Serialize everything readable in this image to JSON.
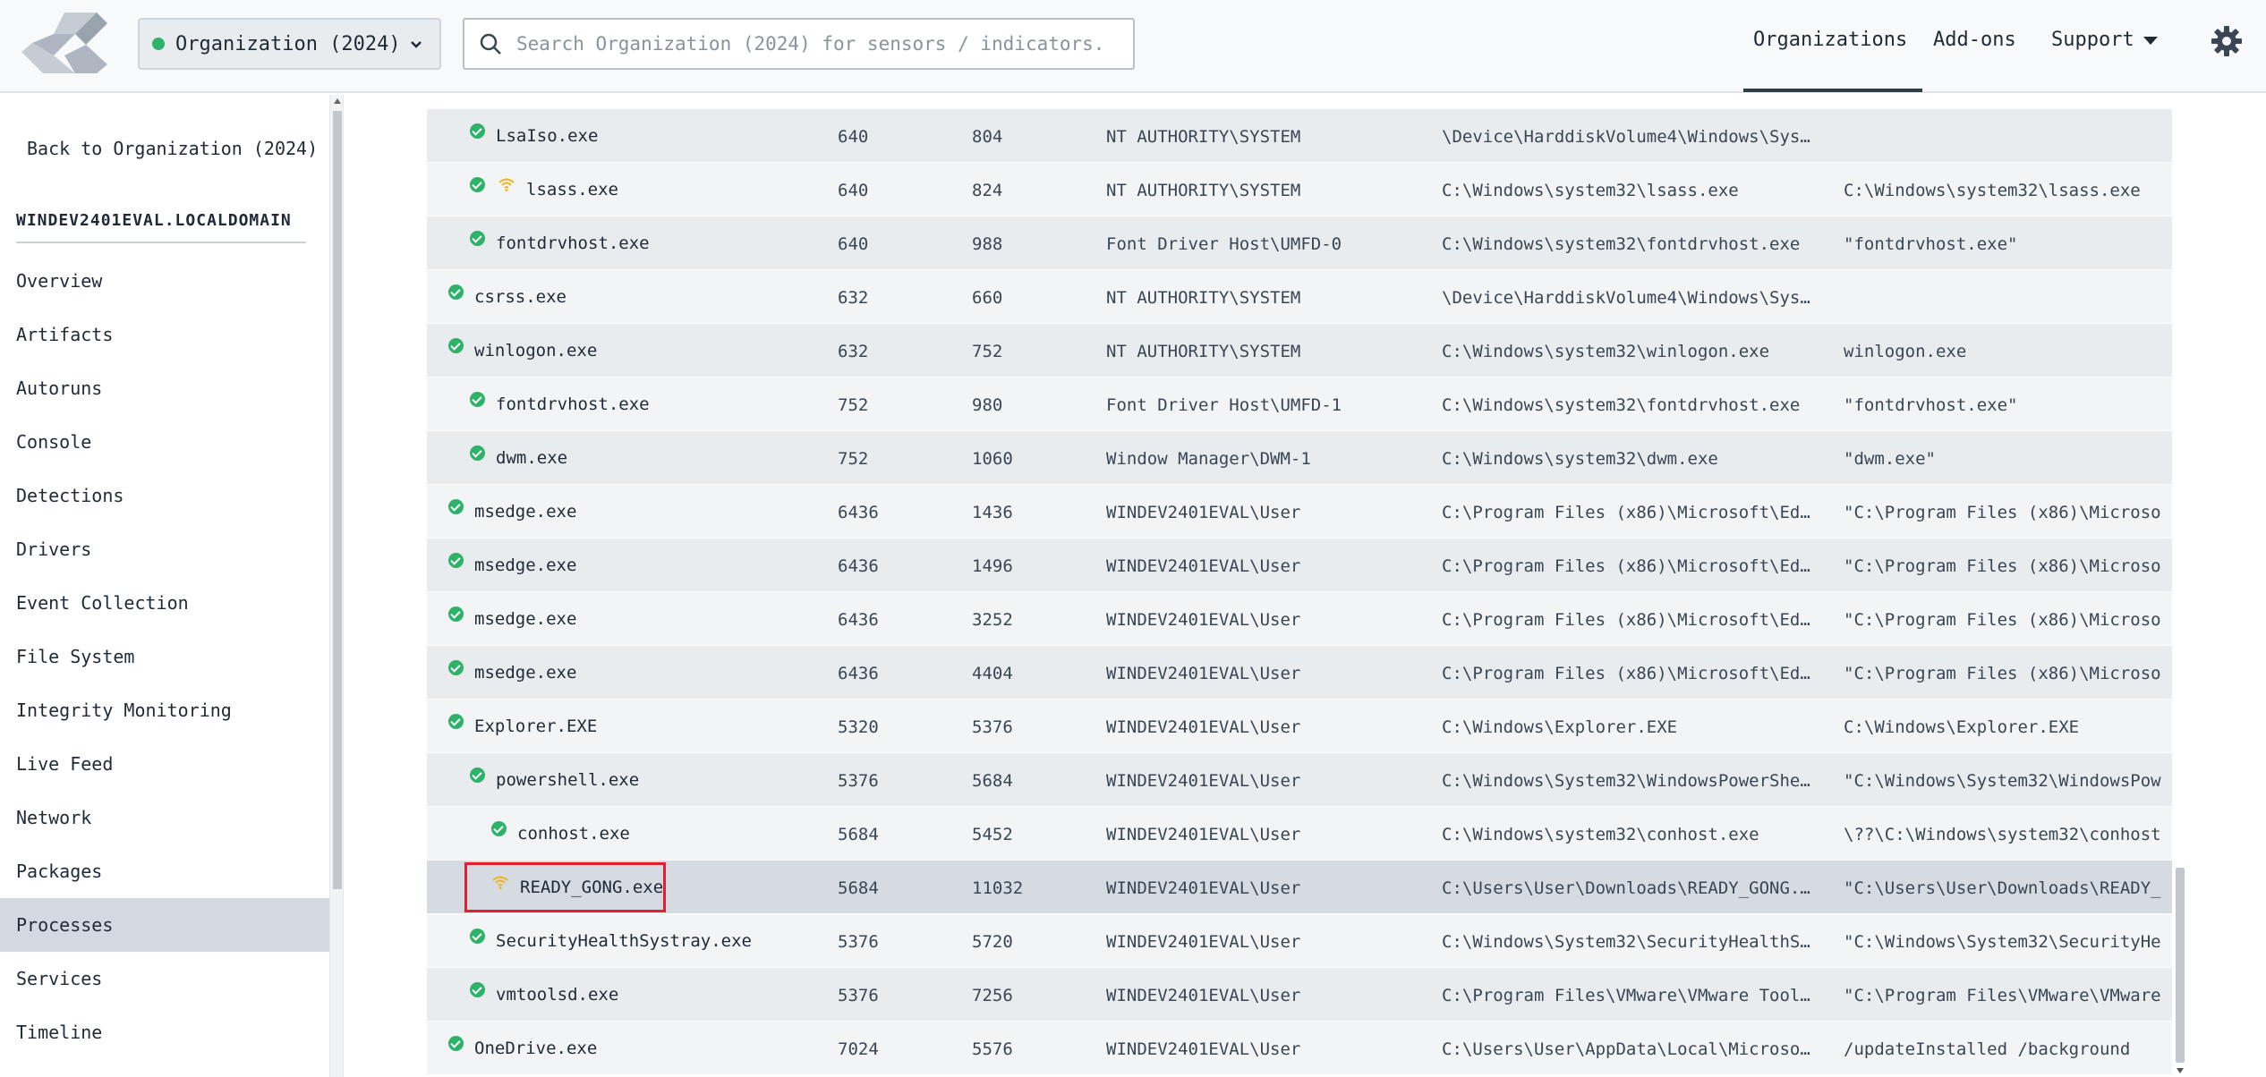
{
  "header": {
    "org_selector": "Organization (2024)",
    "search_placeholder": "Search Organization (2024) for sensors / indicators.",
    "nav": {
      "organizations": "Organizations",
      "addons": "Add-ons",
      "support": "Support"
    },
    "icons": [
      "logo-icon",
      "search-icon",
      "chevron-down-icon",
      "gear-icon"
    ]
  },
  "sidebar": {
    "back_label": "Back to Organization (2024)",
    "hostname": "WINDEV2401EVAL.LOCALDOMAIN",
    "items": [
      {
        "label": "Overview"
      },
      {
        "label": "Artifacts"
      },
      {
        "label": "Autoruns"
      },
      {
        "label": "Console"
      },
      {
        "label": "Detections"
      },
      {
        "label": "Drivers"
      },
      {
        "label": "Event Collection"
      },
      {
        "label": "File System"
      },
      {
        "label": "Integrity Monitoring"
      },
      {
        "label": "Live Feed"
      },
      {
        "label": "Network"
      },
      {
        "label": "Packages"
      },
      {
        "label": "Processes",
        "active": true
      },
      {
        "label": "Services"
      },
      {
        "label": "Timeline"
      }
    ]
  },
  "processes": {
    "rows": [
      {
        "name": "LsaIso.exe",
        "level": 1,
        "icons": [
          "ok"
        ],
        "ppid": "640",
        "pid": "804",
        "user": "NT AUTHORITY\\SYSTEM",
        "path": "\\Device\\HarddiskVolume4\\Windows\\Sys…",
        "cmd": ""
      },
      {
        "name": "lsass.exe",
        "level": 1,
        "icons": [
          "ok",
          "wifi"
        ],
        "ppid": "640",
        "pid": "824",
        "user": "NT AUTHORITY\\SYSTEM",
        "path": "C:\\Windows\\system32\\lsass.exe",
        "cmd": "C:\\Windows\\system32\\lsass.exe"
      },
      {
        "name": "fontdrvhost.exe",
        "level": 1,
        "icons": [
          "ok"
        ],
        "ppid": "640",
        "pid": "988",
        "user": "Font Driver Host\\UMFD-0",
        "path": "C:\\Windows\\system32\\fontdrvhost.exe",
        "cmd": "\"fontdrvhost.exe\""
      },
      {
        "name": "csrss.exe",
        "level": 0,
        "icons": [
          "ok"
        ],
        "ppid": "632",
        "pid": "660",
        "user": "NT AUTHORITY\\SYSTEM",
        "path": "\\Device\\HarddiskVolume4\\Windows\\Sys…",
        "cmd": ""
      },
      {
        "name": "winlogon.exe",
        "level": 0,
        "icons": [
          "ok"
        ],
        "ppid": "632",
        "pid": "752",
        "user": "NT AUTHORITY\\SYSTEM",
        "path": "C:\\Windows\\system32\\winlogon.exe",
        "cmd": "winlogon.exe"
      },
      {
        "name": "fontdrvhost.exe",
        "level": 1,
        "icons": [
          "ok"
        ],
        "ppid": "752",
        "pid": "980",
        "user": "Font Driver Host\\UMFD-1",
        "path": "C:\\Windows\\system32\\fontdrvhost.exe",
        "cmd": "\"fontdrvhost.exe\""
      },
      {
        "name": "dwm.exe",
        "level": 1,
        "icons": [
          "ok"
        ],
        "ppid": "752",
        "pid": "1060",
        "user": "Window Manager\\DWM-1",
        "path": "C:\\Windows\\system32\\dwm.exe",
        "cmd": "\"dwm.exe\""
      },
      {
        "name": "msedge.exe",
        "level": 0,
        "icons": [
          "ok"
        ],
        "ppid": "6436",
        "pid": "1436",
        "user": "WINDEV2401EVAL\\User",
        "path": "C:\\Program Files (x86)\\Microsoft\\Ed…",
        "cmd": "\"C:\\Program Files (x86)\\Microso"
      },
      {
        "name": "msedge.exe",
        "level": 0,
        "icons": [
          "ok"
        ],
        "ppid": "6436",
        "pid": "1496",
        "user": "WINDEV2401EVAL\\User",
        "path": "C:\\Program Files (x86)\\Microsoft\\Ed…",
        "cmd": "\"C:\\Program Files (x86)\\Microso"
      },
      {
        "name": "msedge.exe",
        "level": 0,
        "icons": [
          "ok"
        ],
        "ppid": "6436",
        "pid": "3252",
        "user": "WINDEV2401EVAL\\User",
        "path": "C:\\Program Files (x86)\\Microsoft\\Ed…",
        "cmd": "\"C:\\Program Files (x86)\\Microso"
      },
      {
        "name": "msedge.exe",
        "level": 0,
        "icons": [
          "ok"
        ],
        "ppid": "6436",
        "pid": "4404",
        "user": "WINDEV2401EVAL\\User",
        "path": "C:\\Program Files (x86)\\Microsoft\\Ed…",
        "cmd": "\"C:\\Program Files (x86)\\Microso"
      },
      {
        "name": "Explorer.EXE",
        "level": 0,
        "icons": [
          "ok"
        ],
        "ppid": "5320",
        "pid": "5376",
        "user": "WINDEV2401EVAL\\User",
        "path": "C:\\Windows\\Explorer.EXE",
        "cmd": "C:\\Windows\\Explorer.EXE"
      },
      {
        "name": "powershell.exe",
        "level": 1,
        "icons": [
          "ok"
        ],
        "ppid": "5376",
        "pid": "5684",
        "user": "WINDEV2401EVAL\\User",
        "path": "C:\\Windows\\System32\\WindowsPowerShe…",
        "cmd": "\"C:\\Windows\\System32\\WindowsPow"
      },
      {
        "name": "conhost.exe",
        "level": 2,
        "icons": [
          "ok"
        ],
        "ppid": "5684",
        "pid": "5452",
        "user": "WINDEV2401EVAL\\User",
        "path": "C:\\Windows\\system32\\conhost.exe",
        "cmd": "\\??\\C:\\Windows\\system32\\conhost"
      },
      {
        "name": "READY_GONG.exe",
        "level": 2,
        "icons": [
          "wifi"
        ],
        "ppid": "5684",
        "pid": "11032",
        "user": "WINDEV2401EVAL\\User",
        "path": "C:\\Users\\User\\Downloads\\READY_GONG.…",
        "cmd": "\"C:\\Users\\User\\Downloads\\READY_",
        "selected": true,
        "highlighted": true
      },
      {
        "name": "SecurityHealthSystray.exe",
        "level": 1,
        "icons": [
          "ok"
        ],
        "ppid": "5376",
        "pid": "5720",
        "user": "WINDEV2401EVAL\\User",
        "path": "C:\\Windows\\System32\\SecurityHealthS…",
        "cmd": "\"C:\\Windows\\System32\\SecurityHe"
      },
      {
        "name": "vmtoolsd.exe",
        "level": 1,
        "icons": [
          "ok"
        ],
        "ppid": "5376",
        "pid": "7256",
        "user": "WINDEV2401EVAL\\User",
        "path": "C:\\Program Files\\VMware\\VMware Tool…",
        "cmd": "\"C:\\Program Files\\VMware\\VMware"
      },
      {
        "name": "OneDrive.exe",
        "level": 0,
        "icons": [
          "ok"
        ],
        "ppid": "7024",
        "pid": "5576",
        "user": "WINDEV2401EVAL\\User",
        "path": "C:\\Users\\User\\AppData\\Local\\Microso…",
        "cmd": "/updateInstalled /background"
      }
    ]
  },
  "colors": {
    "ok_green": "#2fb36a",
    "wifi_yellow": "#e8b51a",
    "highlight_red": "#e0202e",
    "active_nav": "#d3d9e0"
  }
}
